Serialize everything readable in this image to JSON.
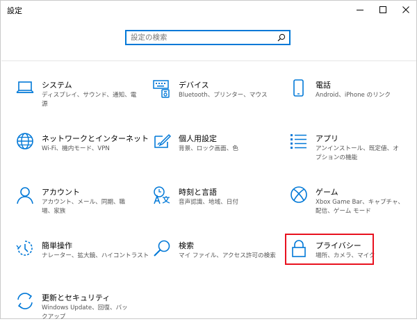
{
  "window": {
    "title": "設定",
    "controls": {
      "minimize": "minimize-icon",
      "maximize": "maximize-icon",
      "close": "close-icon"
    }
  },
  "search": {
    "placeholder": "設定の検索",
    "value": ""
  },
  "colors": {
    "accent": "#0078d7",
    "highlight": "#e8111e"
  },
  "categories": [
    {
      "name": "システム",
      "desc": "ディスプレイ、サウンド、通知、電源",
      "icon": "laptop-icon"
    },
    {
      "name": "デバイス",
      "desc": "Bluetooth、プリンター、マウス",
      "icon": "keyboard-icon"
    },
    {
      "name": "電話",
      "desc": "Android、iPhone のリンク",
      "icon": "phone-icon"
    },
    {
      "name": "ネットワークとインターネット",
      "desc": "Wi-Fi、機内モード、VPN",
      "icon": "globe-icon"
    },
    {
      "name": "個人用設定",
      "desc": "背景、ロック画面、色",
      "icon": "paint-icon"
    },
    {
      "name": "アプリ",
      "desc": "アンインストール、既定値、オプションの機能",
      "icon": "apps-list-icon"
    },
    {
      "name": "アカウント",
      "desc": "アカウント、メール、同期、職場、家族",
      "icon": "person-icon"
    },
    {
      "name": "時刻と言語",
      "desc": "音声認識、地域、日付",
      "icon": "time-language-icon"
    },
    {
      "name": "ゲーム",
      "desc": "Xbox Game Bar、キャプチャ、配信、ゲーム モード",
      "icon": "xbox-icon"
    },
    {
      "name": "簡単操作",
      "desc": "ナレーター、拡大鏡、ハイコントラスト",
      "icon": "ease-of-access-icon"
    },
    {
      "name": "検索",
      "desc": "マイ ファイル、アクセス許可の検索",
      "icon": "magnifier-icon"
    },
    {
      "name": "プライバシー",
      "desc": "場所、カメラ、マイク",
      "icon": "lock-icon"
    },
    {
      "name": "更新とセキュリティ",
      "desc": "Windows Update、回復、バックアップ",
      "icon": "sync-icon"
    }
  ]
}
